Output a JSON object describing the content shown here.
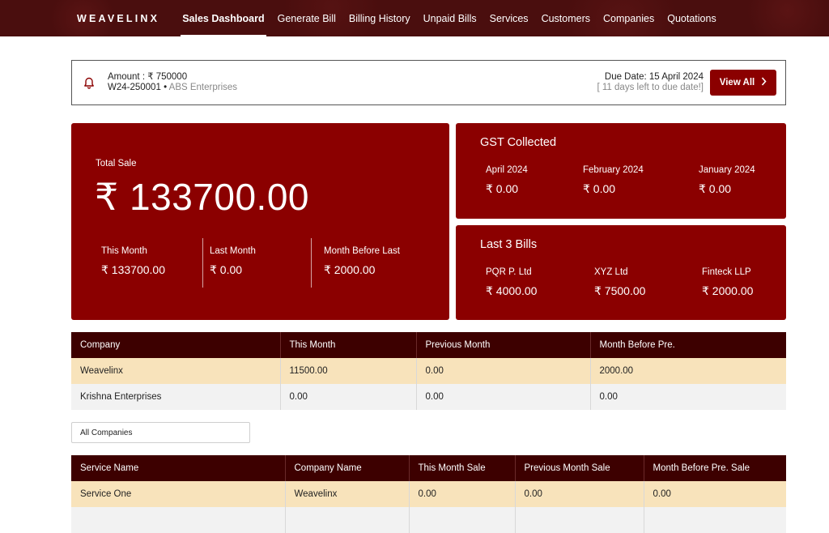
{
  "nav": {
    "brand": "WEAVELINX",
    "items": [
      {
        "label": "Sales Dashboard",
        "active": true
      },
      {
        "label": "Generate Bill"
      },
      {
        "label": "Billing History"
      },
      {
        "label": "Unpaid Bills"
      },
      {
        "label": "Services"
      },
      {
        "label": "Customers"
      },
      {
        "label": "Companies"
      },
      {
        "label": "Quotations"
      }
    ]
  },
  "alert": {
    "icon": "bell-icon",
    "amount": "Amount : ₹ 750000",
    "code": "W24-250001",
    "separator": "•",
    "company": "ABS Enterprises",
    "due_date": "Due Date: 15 April 2024",
    "days_left": "[ 11 days left to due date!]",
    "button_label": "View All",
    "button_icon": "chevron-right-icon"
  },
  "total_sale": {
    "label": "Total Sale",
    "value": "₹ 133700.00",
    "this_month_label": "This Month",
    "this_month_value": "₹ 133700.00",
    "last_month_label": "Last Month",
    "last_month_value": "₹ 0.00",
    "month_before_label": "Month Before Last",
    "month_before_value": "₹ 2000.00"
  },
  "gst": {
    "title": "GST Collected",
    "cols": [
      {
        "label": "April 2024",
        "value": "₹ 0.00"
      },
      {
        "label": "February 2024",
        "value": "₹ 0.00"
      },
      {
        "label": "January 2024",
        "value": "₹ 0.00"
      }
    ]
  },
  "bills": {
    "title": "Last 3 Bills",
    "cols": [
      {
        "label": "PQR P. Ltd",
        "value": "₹ 4000.00"
      },
      {
        "label": "XYZ Ltd",
        "value": "₹ 7500.00"
      },
      {
        "label": "Finteck LLP",
        "value": "₹ 2000.00"
      }
    ]
  },
  "company_table": {
    "headers": [
      "Company",
      "This Month",
      "Previous Month",
      "Month Before Pre."
    ],
    "rows": [
      [
        "Weavelinx",
        "11500.00",
        "0.00",
        "2000.00"
      ],
      [
        "Krishna Enterprises",
        "0.00",
        "0.00",
        "0.00"
      ]
    ]
  },
  "filter": {
    "selected": "All Companies"
  },
  "service_table": {
    "headers": [
      "Service Name",
      "Company Name",
      "This Month Sale",
      "Previous Month Sale",
      "Month Before Pre. Sale"
    ],
    "rows": [
      [
        "Service One",
        "Weavelinx",
        "0.00",
        "0.00",
        "0.00"
      ],
      [
        "",
        "",
        "",
        "",
        ""
      ]
    ]
  },
  "colors": {
    "nav_bg": "#4a0e0e",
    "card_bg": "#8b0000",
    "table_header": "#3d0000",
    "highlight_row": "#f8e3bb"
  }
}
